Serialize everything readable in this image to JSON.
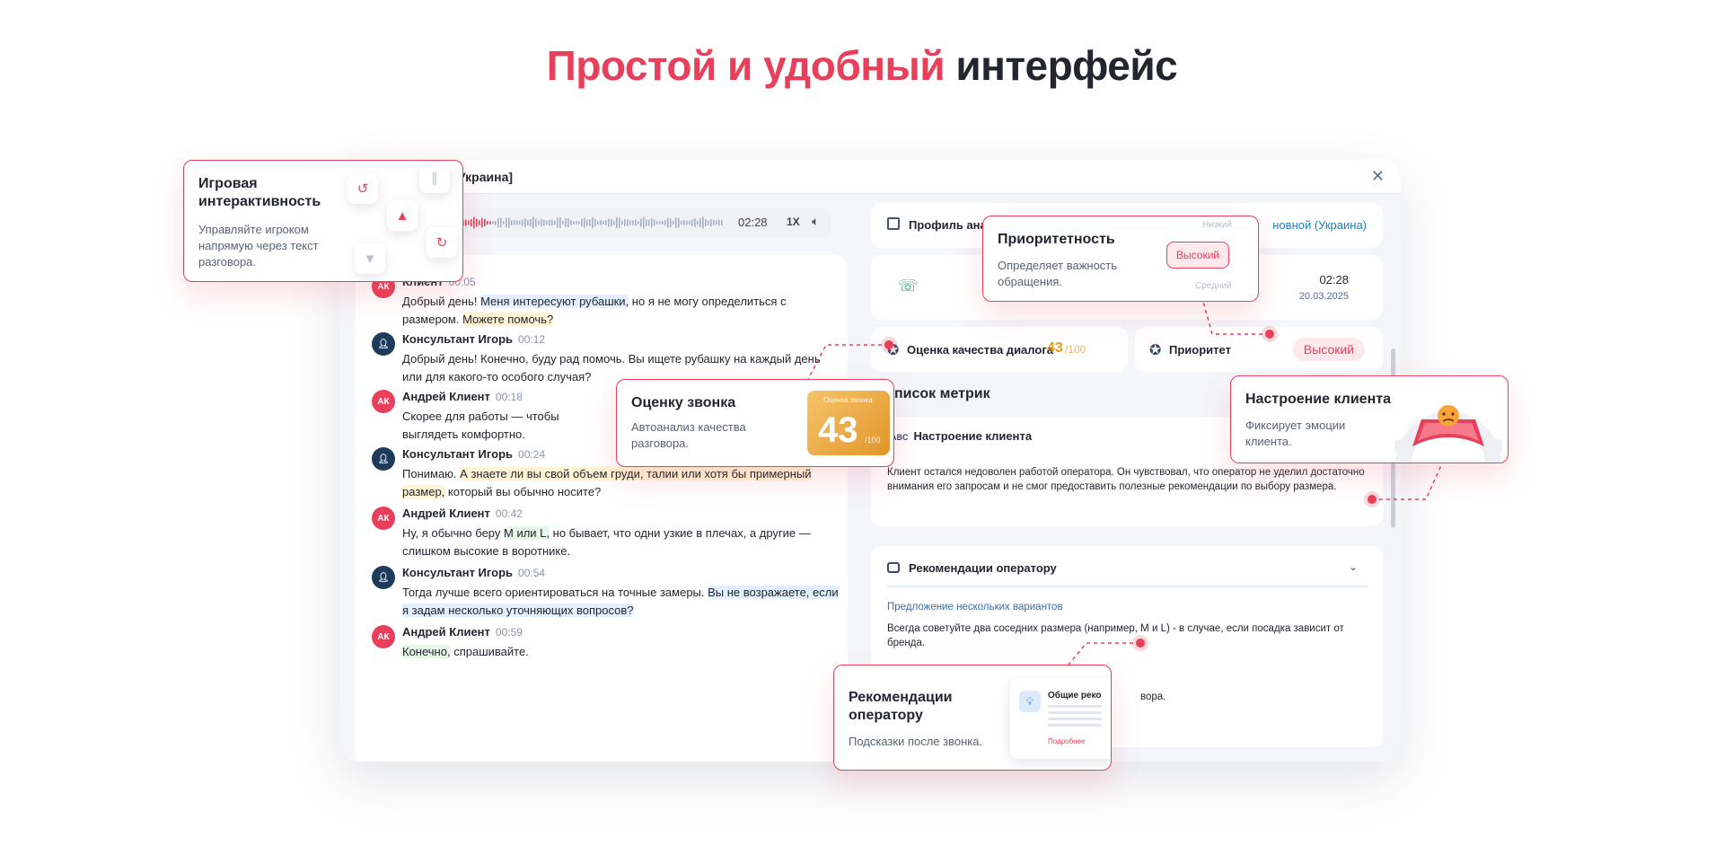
{
  "headline": {
    "accent": "Простой и удобный",
    "rest": "интерфейс"
  },
  "window": {
    "title": "Украина]"
  },
  "player": {
    "time": "02:28",
    "speed": "1X",
    "volume_icon": "speaker-icon"
  },
  "chat": {
    "messages": [
      {
        "role": "client",
        "avatar": "АК",
        "name": "Клиент",
        "time": "00:05",
        "parts": [
          "Добрый день! ",
          "Меня интересуют рубашки,",
          " но я не могу определиться с размером. ",
          "Можете помочь?"
        ]
      },
      {
        "role": "agent",
        "avatar": "",
        "name": "Консультант Игорь",
        "time": "00:12",
        "text": "Добрый день! Конечно, буду рад помочь. Вы ищете рубашку на каждый день или для какого-то особого случая?"
      },
      {
        "role": "client",
        "avatar": "АК",
        "name": "Андрей Клиент",
        "time": "00:18",
        "text": "Скорее для работы — чтобы выглядеть комфортно."
      },
      {
        "role": "agent",
        "avatar": "",
        "name": "Консультант Игорь",
        "time": "00:24",
        "parts": [
          "Понимаю. ",
          "А знаете ли вы свой объем груди, талии или хотя бы примерный размер,",
          " который вы обычно носите?"
        ]
      },
      {
        "role": "client",
        "avatar": "АК",
        "name": "Андрей Клиент",
        "time": "00:42",
        "parts": [
          "Ну, я обычно беру ",
          "M или L,",
          " но бывает, что одни узкие в плечах, а другие — слишком высокие в воротнике."
        ]
      },
      {
        "role": "agent",
        "avatar": "",
        "name": "Консультант Игорь",
        "time": "00:54",
        "parts": [
          "Тогда лучше всего ориентироваться на точные замеры. ",
          "Вы не возражаете, если я задам несколько уточняющих вопросов?"
        ]
      },
      {
        "role": "client",
        "avatar": "АК",
        "name": "Андрей Клиент",
        "time": "00:59",
        "parts": [
          "Конечно,",
          " спрашивайте."
        ]
      }
    ]
  },
  "profile": {
    "label": "Профиль ана",
    "language": "новной (Украина)"
  },
  "call": {
    "time": "02:28",
    "date": "20.03.2025"
  },
  "quality": {
    "label": "Оценка качества диалога",
    "score": "43",
    "max": "/100"
  },
  "priority": {
    "label": "Приоритет",
    "value": "Высокий"
  },
  "metrics": {
    "title": "писок метрик"
  },
  "mood": {
    "label": "Настроение клиента",
    "abc": "ABC",
    "text": "Клиент остался недоволен работой оператора. Он чувствовал, что оператор не уделил достаточно внимания его запросам и не смог предоставить полезные рекомендации по выбору размера."
  },
  "recommendations": {
    "label": "Рекомендации оператору",
    "subtitle": "Предложение нескольких вариантов",
    "text": "Всегда советуйте два соседних размера (например, M и L) - в случае, если посадка зависит от бренда.",
    "tail": "вора."
  },
  "callouts": {
    "game": {
      "title": "Игровая интерактивность",
      "desc": "Управляйте игроком напрямую через текст разговора."
    },
    "priority": {
      "title": "Приоритетность",
      "desc": "Определяет важность обращения.",
      "high": "Высокий",
      "low": "Низкий",
      "mid": "Средний"
    },
    "score": {
      "title": "Оценку звонка",
      "desc": "Автоанализ качества разговора.",
      "tile_label": "Оценка звонка",
      "tile_value": "43",
      "tile_max": "/100"
    },
    "mood": {
      "title": "Настроение клиента",
      "desc": "Фиксирует эмоции клиента."
    },
    "rec": {
      "title": "Рекомендации оператору",
      "desc": "Подсказки после звонка.",
      "mini_title": "Общие реко",
      "mini_link": "Подробнее"
    }
  },
  "colors": {
    "accent": "#e8405a",
    "score": "#e89a1b",
    "link": "#1c7fbd"
  }
}
